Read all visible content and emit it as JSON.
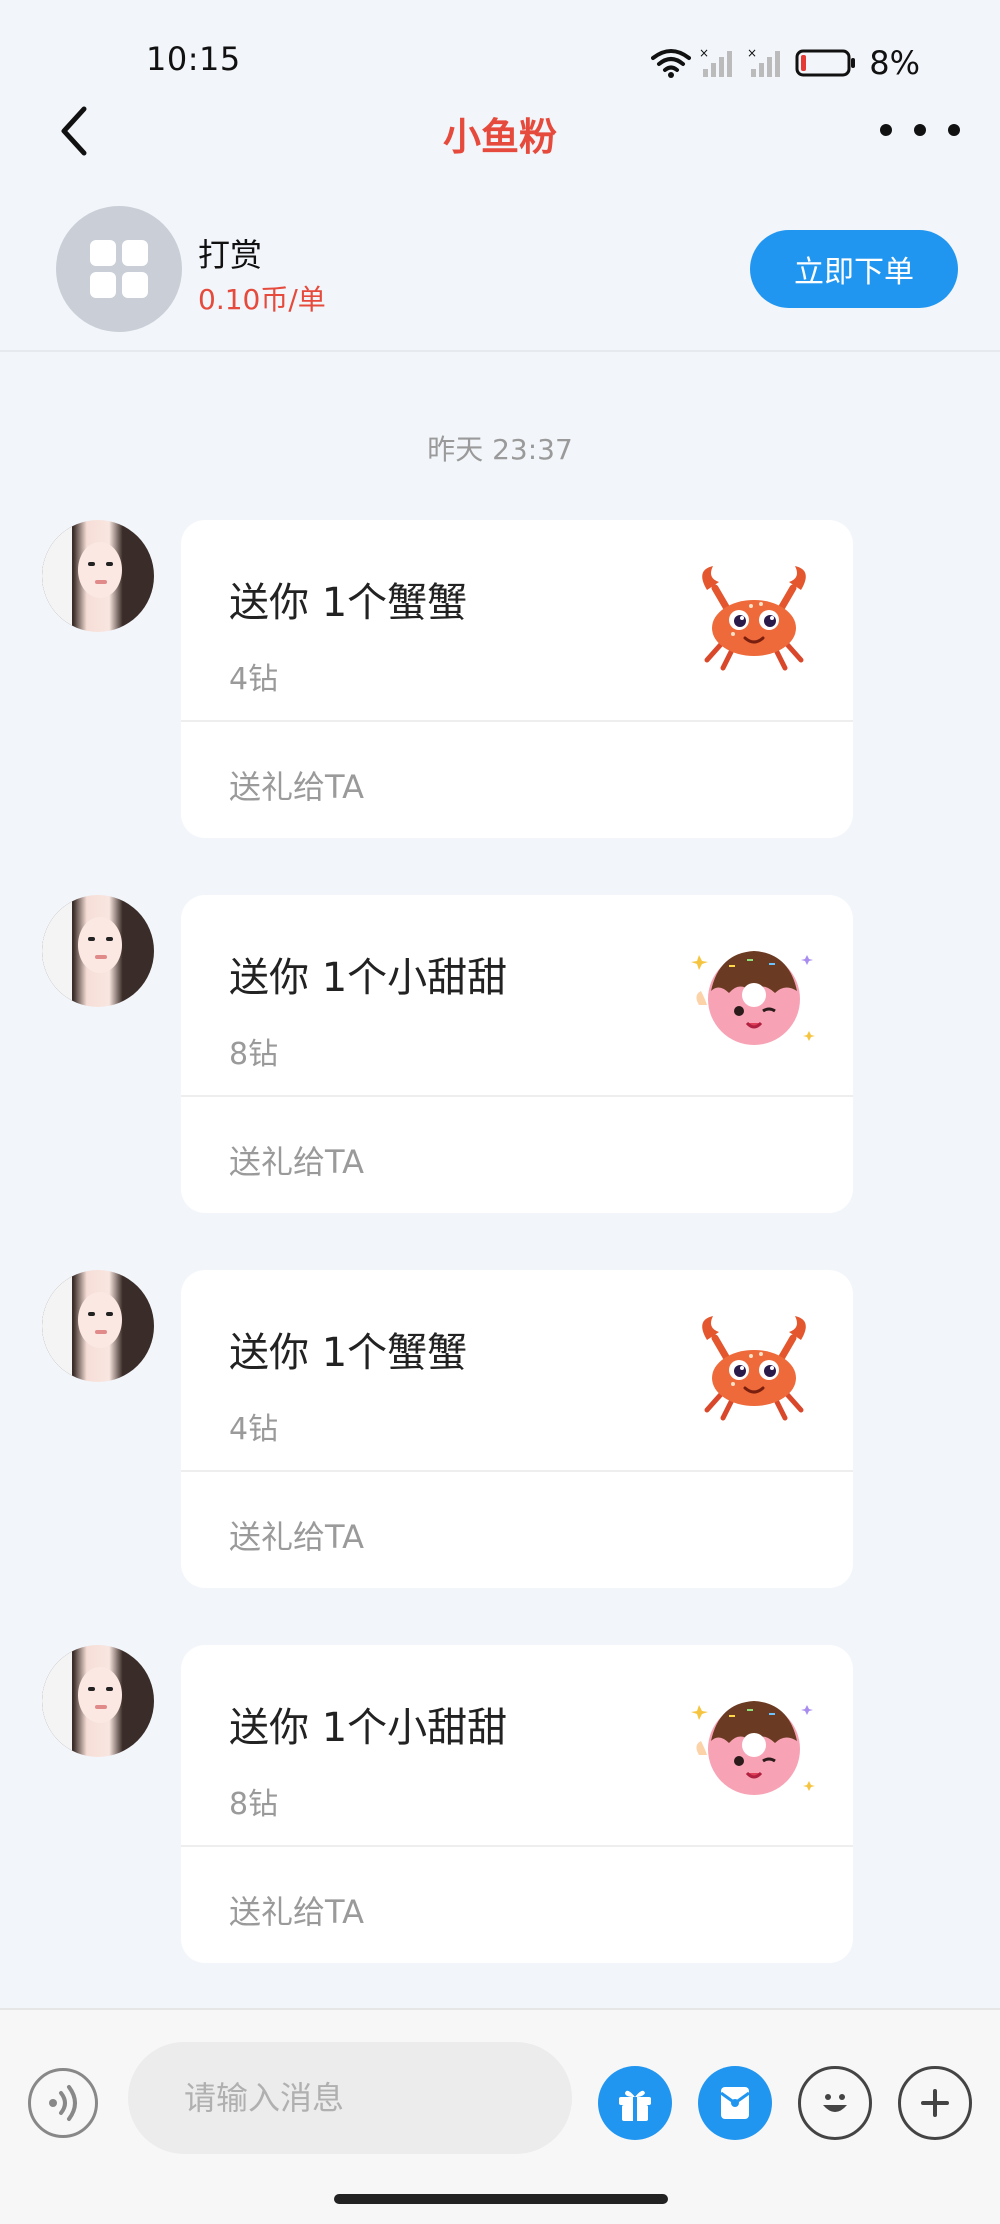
{
  "status_bar": {
    "time": "10:15",
    "battery": "8%"
  },
  "nav": {
    "title": "小鱼粉"
  },
  "service": {
    "name": "打赏",
    "price": "0.10币/单",
    "order_button": "立即下单"
  },
  "chat": {
    "timestamp": "昨天 23:37",
    "messages": [
      {
        "title": "送你 1个蟹蟹",
        "price": "4钻",
        "action": "送礼给TA",
        "gift_icon": "crab-icon"
      },
      {
        "title": "送你 1个小甜甜",
        "price": "8钻",
        "action": "送礼给TA",
        "gift_icon": "donut-icon"
      },
      {
        "title": "送你 1个蟹蟹",
        "price": "4钻",
        "action": "送礼给TA",
        "gift_icon": "crab-icon"
      },
      {
        "title": "送你 1个小甜甜",
        "price": "8钻",
        "action": "送礼给TA",
        "gift_icon": "donut-icon"
      }
    ]
  },
  "input_bar": {
    "placeholder": "请输入消息"
  },
  "colors": {
    "accent": "#2196f0",
    "title_red": "#e54a3c",
    "background": "#f2f5f9"
  }
}
